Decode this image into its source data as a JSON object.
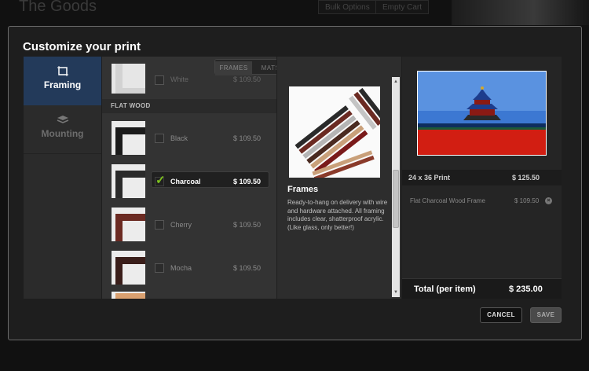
{
  "background": {
    "title": "The Goods",
    "buttons": [
      "Bulk Options",
      "Empty Cart"
    ]
  },
  "modal": {
    "title": "Customize your print",
    "nav": [
      {
        "label": "Framing",
        "icon": "frame-icon",
        "active": true
      },
      {
        "label": "Mounting",
        "icon": "layers-icon",
        "active": false
      }
    ],
    "tabs": [
      {
        "label": "FRAMES",
        "active": true
      },
      {
        "label": "MATS",
        "active": false
      }
    ],
    "partial_item": {
      "name": "White",
      "price": "$ 109.50"
    },
    "section_header": "FLAT WOOD",
    "options": [
      {
        "name": "Black",
        "price": "$ 109.50",
        "selected": false,
        "color": "#1b1b1b"
      },
      {
        "name": "Charcoal",
        "price": "$ 109.50",
        "selected": true,
        "color": "#2a2a2a"
      },
      {
        "name": "Cherry",
        "price": "$ 109.50",
        "selected": false,
        "color": "#6b2a22"
      },
      {
        "name": "Mocha",
        "price": "$ 109.50",
        "selected": false,
        "color": "#3a1e1a"
      }
    ],
    "detail": {
      "title": "Frames",
      "description": "Ready-to-hang on delivery with wire and hardware attached. All framing includes clear, shatterproof acrylic. (Like glass, only better!)"
    },
    "summary": {
      "print_label": "24 x 36 Print",
      "print_price": "$ 125.50",
      "frame_label": "Flat Charcoal Wood Frame",
      "frame_price": "$ 109.50",
      "total_label": "Total (per item)",
      "total_price": "$ 235.00"
    },
    "buttons": {
      "cancel": "CANCEL",
      "save": "SAVE"
    }
  }
}
